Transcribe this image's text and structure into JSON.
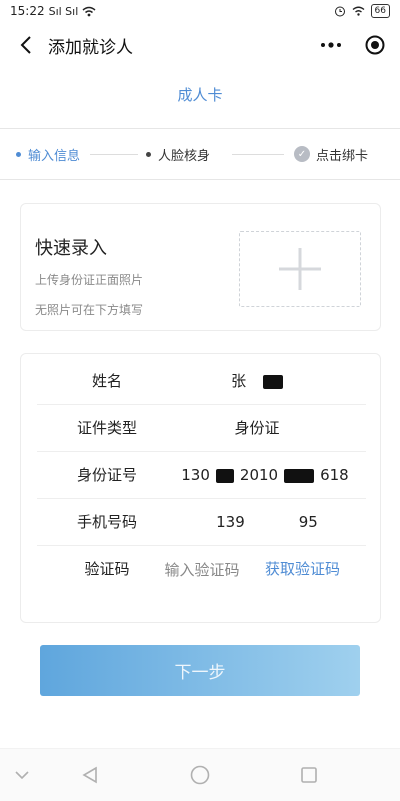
{
  "status_bar": {
    "time": "15:22",
    "signal": "Sıl Sıl",
    "battery": "66"
  },
  "nav": {
    "title": "添加就诊人",
    "more_icon": "more-dots-icon",
    "target_icon": "target-icon"
  },
  "card_type": "成人卡",
  "steps": [
    {
      "label": "输入信息",
      "state": "active"
    },
    {
      "label": "人脸核身",
      "state": "pending"
    },
    {
      "label": "点击绑卡",
      "state": "pending"
    }
  ],
  "quick_entry": {
    "title": "快速录入",
    "subtitle1": "上传身份证正面照片",
    "subtitle2": "无照片可在下方填写"
  },
  "form": {
    "name": {
      "label": "姓名",
      "value": "张"
    },
    "id_type": {
      "label": "证件类型",
      "value": "身份证"
    },
    "id_number": {
      "label": "身份证号",
      "part1": "130",
      "part2": "2010",
      "part3": "618"
    },
    "phone": {
      "label": "手机号码",
      "part1": "139",
      "part2": "95"
    },
    "code": {
      "label": "验证码",
      "placeholder": "输入验证码",
      "get_code": "获取验证码"
    }
  },
  "next_button": "下一步",
  "colors": {
    "accent": "#4f8cd4",
    "button_start": "#5fa6dd",
    "button_end": "#9fd0ee"
  }
}
